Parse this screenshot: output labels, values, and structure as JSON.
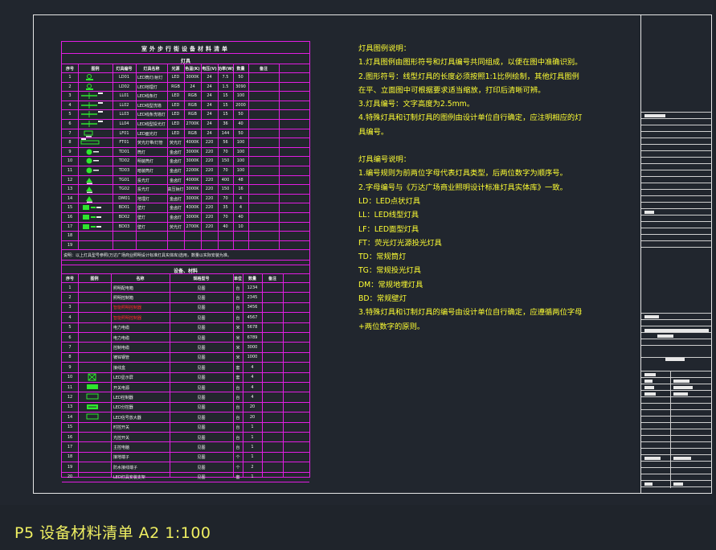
{
  "sheet_caption": "P5 设备材料清单 A2 1:100",
  "materials_table": {
    "title": "室外步行街设备材料清单",
    "lamps_section": "灯具",
    "lamps_columns": [
      "序号",
      "图例",
      "灯具编号",
      "灯具名称",
      "光源",
      "色温(K)",
      "电压(V)",
      "功率(W)",
      "数量",
      "备注"
    ],
    "lamps_rows": [
      {
        "no": "1",
        "code": "LD01",
        "name": "LED筒灯/射灯",
        "src": "LED",
        "temp": "3000K",
        "volt": "24",
        "power": "7.5",
        "qty": "50",
        "icon": "down"
      },
      {
        "no": "2",
        "code": "LD02",
        "name": "LED地埋灯",
        "src": "RGB",
        "temp": "24",
        "volt": "24",
        "power": "1.5",
        "qty": "3090",
        "icon": "down"
      },
      {
        "no": "3",
        "code": "LL01",
        "name": "LED线条灯",
        "src": "LED",
        "temp": "RGB",
        "volt": "24",
        "power": "15",
        "qty": "100",
        "icon": "line"
      },
      {
        "no": "4",
        "code": "LL02",
        "name": "LED线型洗墙",
        "src": "LED",
        "temp": "RGB",
        "volt": "24",
        "power": "15",
        "qty": "2000",
        "icon": "line"
      },
      {
        "no": "5",
        "code": "LL03",
        "name": "LED线条洗墙灯",
        "src": "LED",
        "temp": "RGB",
        "volt": "24",
        "power": "15",
        "qty": "50",
        "icon": "line"
      },
      {
        "no": "6",
        "code": "LL04",
        "name": "LED线型投光灯",
        "src": "LED",
        "temp": "2700K",
        "volt": "24",
        "power": "36",
        "qty": "40",
        "icon": "line"
      },
      {
        "no": "7",
        "code": "LF01",
        "name": "LED面光灯",
        "src": "LED",
        "temp": "RGB",
        "volt": "24",
        "power": "144",
        "qty": "50",
        "icon": "face"
      },
      {
        "no": "8",
        "code": "FT01",
        "name": "荧光灯带/灯管",
        "src": "荧光灯",
        "temp": "4000K",
        "volt": "220",
        "power": "56",
        "qty": "100",
        "icon": "tube"
      },
      {
        "no": "9",
        "code": "TD01",
        "name": "筒灯",
        "src": "金卤灯",
        "temp": "3000K",
        "volt": "220",
        "power": "70",
        "qty": "100",
        "icon": "spot"
      },
      {
        "no": "10",
        "code": "TD02",
        "name": "明装筒灯",
        "src": "金卤灯",
        "temp": "3000K",
        "volt": "220",
        "power": "150",
        "qty": "100",
        "icon": "spot"
      },
      {
        "no": "11",
        "code": "TD03",
        "name": "暗装筒灯",
        "src": "金卤灯",
        "temp": "2200K",
        "volt": "220",
        "power": "70",
        "qty": "100",
        "icon": "spot"
      },
      {
        "no": "12",
        "code": "TG01",
        "name": "投光灯",
        "src": "金卤灯",
        "temp": "4000K",
        "volt": "220",
        "power": "400",
        "qty": "48",
        "icon": "proj"
      },
      {
        "no": "13",
        "code": "TG02",
        "name": "投光灯",
        "src": "高压钠灯",
        "temp": "3000K",
        "volt": "220",
        "power": "150",
        "qty": "16",
        "icon": "proj"
      },
      {
        "no": "14",
        "code": "DM01",
        "name": "地埋灯",
        "src": "金卤灯",
        "temp": "3000K",
        "volt": "220",
        "power": "70",
        "qty": "4",
        "icon": "proj"
      },
      {
        "no": "15",
        "code": "BD01",
        "name": "壁灯",
        "src": "金卤灯",
        "temp": "4300K",
        "volt": "220",
        "power": "35",
        "qty": "4",
        "icon": "wall"
      },
      {
        "no": "16",
        "code": "BD02",
        "name": "壁灯",
        "src": "金卤灯",
        "temp": "3000K",
        "volt": "220",
        "power": "70",
        "qty": "40",
        "icon": "wall"
      },
      {
        "no": "17",
        "code": "BD03",
        "name": "壁灯",
        "src": "荧光灯",
        "temp": "2700K",
        "volt": "220",
        "power": "40",
        "qty": "10",
        "icon": "wall"
      },
      {
        "no": "18",
        "code": "",
        "name": "",
        "src": "",
        "temp": "",
        "volt": "",
        "power": "",
        "qty": "",
        "icon": ""
      },
      {
        "no": "19",
        "code": "",
        "name": "",
        "src": "",
        "temp": "",
        "volt": "",
        "power": "",
        "qty": "",
        "icon": ""
      }
    ],
    "remark": "说明：以上灯具型号参照(万达广场商业照明设计标准灯具实体库)选用，数量以实际安装为准。",
    "equip_section": "设备、材料",
    "equip_columns": [
      "序号",
      "图例",
      "名称",
      "规格型号",
      "单位",
      "数量",
      "备注"
    ],
    "equip_rows": [
      {
        "no": "1",
        "name": "照明配电箱",
        "spec": "见图",
        "unit": "台",
        "qty": "1234",
        "red": false,
        "icon": ""
      },
      {
        "no": "2",
        "name": "照明控制箱",
        "spec": "见图",
        "unit": "台",
        "qty": "2345",
        "red": false,
        "icon": ""
      },
      {
        "no": "3",
        "name": "智能照明控制器",
        "spec": "见图",
        "unit": "台",
        "qty": "3456",
        "red": true,
        "icon": ""
      },
      {
        "no": "4",
        "name": "智能照明控制器",
        "spec": "见图",
        "unit": "台",
        "qty": "4567",
        "red": true,
        "icon": ""
      },
      {
        "no": "5",
        "name": "电力电缆",
        "spec": "见图",
        "unit": "米",
        "qty": "5678",
        "red": false,
        "icon": ""
      },
      {
        "no": "6",
        "name": "电力电缆",
        "spec": "见图",
        "unit": "米",
        "qty": "6789",
        "red": false,
        "icon": ""
      },
      {
        "no": "7",
        "name": "控制电缆",
        "spec": "见图",
        "unit": "米",
        "qty": "3000",
        "red": false,
        "icon": ""
      },
      {
        "no": "8",
        "name": "镀锌钢管",
        "spec": "见图",
        "unit": "米",
        "qty": "1000",
        "red": false,
        "icon": ""
      },
      {
        "no": "9",
        "name": "接线盒",
        "spec": "见图",
        "unit": "套",
        "qty": "4",
        "red": false,
        "icon": ""
      },
      {
        "no": "10",
        "name": "LED显示屏",
        "spec": "见图",
        "unit": "套",
        "qty": "4",
        "red": false,
        "icon": "x"
      },
      {
        "no": "11",
        "name": "开关电源",
        "spec": "见图",
        "unit": "台",
        "qty": "4",
        "red": false,
        "icon": "solid"
      },
      {
        "no": "12",
        "name": "LED控制器",
        "spec": "见图",
        "unit": "台",
        "qty": "4",
        "red": false,
        "icon": "outline"
      },
      {
        "no": "13",
        "name": "LED分控器",
        "spec": "见图",
        "unit": "台",
        "qty": "20",
        "red": false,
        "icon": "solid2"
      },
      {
        "no": "14",
        "name": "LED信号放大器",
        "spec": "见图",
        "unit": "台",
        "qty": "20",
        "red": false,
        "icon": "outline"
      },
      {
        "no": "15",
        "name": "时控开关",
        "spec": "见图",
        "unit": "台",
        "qty": "1",
        "red": false,
        "icon": ""
      },
      {
        "no": "16",
        "name": "光控开关",
        "spec": "见图",
        "unit": "台",
        "qty": "1",
        "red": false,
        "icon": ""
      },
      {
        "no": "17",
        "name": "主控电脑",
        "spec": "见图",
        "unit": "台",
        "qty": "1",
        "red": false,
        "icon": ""
      },
      {
        "no": "18",
        "name": "接地端子",
        "spec": "见图",
        "unit": "个",
        "qty": "1",
        "red": false,
        "icon": ""
      },
      {
        "no": "19",
        "name": "防水接线端子",
        "spec": "见图",
        "unit": "个",
        "qty": "2",
        "red": false,
        "icon": ""
      },
      {
        "no": "20",
        "name": "LED灯具安装支架",
        "spec": "见图",
        "unit": "套",
        "qty": "1",
        "red": false,
        "icon": ""
      }
    ]
  },
  "notes": {
    "legend_title": "灯具图例说明：",
    "legend_items": [
      "1.灯具图例由图形符号和灯具编号共同组成，以便在图中准确识别。",
      "2.图形符号：线型灯具的长度必须按照1:1比例绘制，其他灯具图例",
      "在平、立面图中可根据要求适当缩放，打印后清晰可辨。",
      "3.灯具编号：文字高度为2.5mm。",
      "4.特殊灯具和订制灯具的图例由设计单位自行确定，应注明相应的灯",
      "具编号。"
    ],
    "code_title": "灯具编号说明：",
    "code_items": [
      "1.编号规则为前两位字母代表灯具类型，后两位数字为顺序号。",
      "2.字母编号与《万达广场商业照明设计标准灯具实体库》一致。",
      "LD：LED点状灯具",
      "LL：LED线型灯具",
      "LF：LED面型灯具",
      "FT：荧光灯光源投光灯具",
      "TD：常规筒灯",
      "TG：常规投光灯具",
      "DM：常规地埋灯具",
      "BD：常规壁灯",
      "3.特殊灯具和订制灯具的编号由设计单位自行确定，应遵循两位字母",
      "+两位数字的原则。"
    ]
  },
  "colors": {
    "table_line": "#e21de2",
    "notes_text": "#ffff33",
    "icon_green": "#2ee62e",
    "frame": "#e6e6e6"
  }
}
